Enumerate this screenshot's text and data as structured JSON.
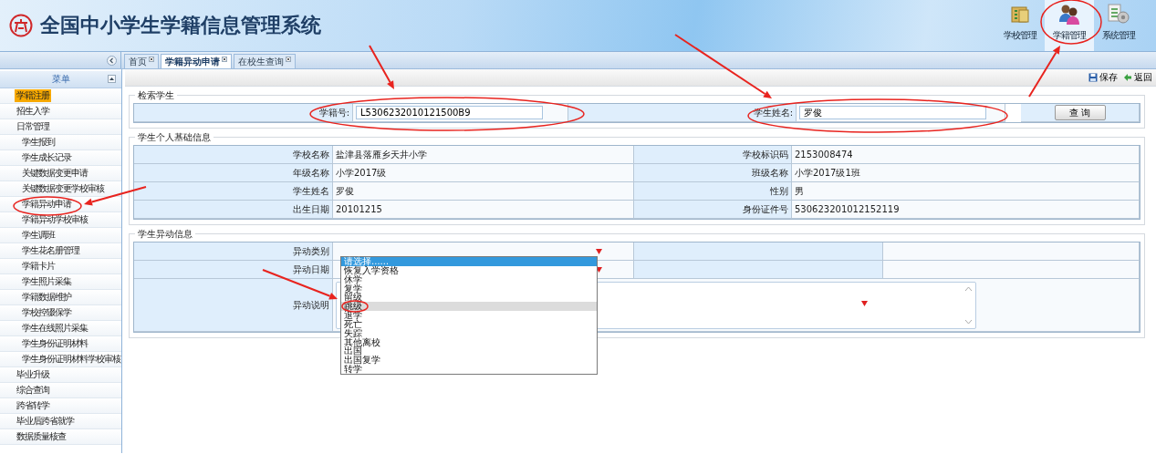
{
  "header": {
    "title": "全国中小学生学籍信息管理系统"
  },
  "top_nav": [
    {
      "label": "学校管理",
      "selected": false
    },
    {
      "label": "学籍管理",
      "selected": true
    },
    {
      "label": "系统管理",
      "selected": false
    }
  ],
  "sidebar": {
    "title": "菜单",
    "items": [
      {
        "label": "学籍注册",
        "selected": true
      },
      {
        "label": "招生入学",
        "selected": false
      },
      {
        "label": "日常管理",
        "selected": false,
        "children": [
          {
            "label": "学生报到",
            "selected": false
          },
          {
            "label": "学生成长记录",
            "selected": false
          },
          {
            "label": "关键数据变更申请",
            "selected": false
          },
          {
            "label": "关键数据变更学校审核",
            "selected": false
          },
          {
            "label": "学籍异动申请",
            "selected": false
          },
          {
            "label": "学籍异动学校审核",
            "selected": false
          },
          {
            "label": "学生调班",
            "selected": false
          },
          {
            "label": "学生花名册管理",
            "selected": false
          },
          {
            "label": "学籍卡片",
            "selected": false
          },
          {
            "label": "学生照片采集",
            "selected": false
          },
          {
            "label": "学籍数据维护",
            "selected": false
          },
          {
            "label": "学校控辍保学",
            "selected": false
          },
          {
            "label": "学生在线照片采集",
            "selected": false
          },
          {
            "label": "学生身份证明材料",
            "selected": false
          },
          {
            "label": "学生身份证明材料学校审核",
            "selected": false
          }
        ]
      },
      {
        "label": "毕业升级",
        "selected": false
      },
      {
        "label": "综合查询",
        "selected": false
      },
      {
        "label": "跨省转学",
        "selected": false
      },
      {
        "label": "毕业后跨省就学",
        "selected": false
      },
      {
        "label": "数据质量核查",
        "selected": false
      }
    ]
  },
  "tabs": [
    {
      "label": "首页",
      "selected": false
    },
    {
      "label": "学籍异动申请",
      "selected": true
    },
    {
      "label": "在校生查询",
      "selected": false
    }
  ],
  "toolbar": [
    {
      "label": "保存"
    },
    {
      "label": "返回"
    }
  ],
  "search": {
    "title": "检索学生",
    "fields": [
      {
        "label": "学籍号:",
        "value": "L5306232010121500B9"
      },
      {
        "label": "学生姓名:",
        "value": "罗俊"
      }
    ],
    "button": "查 询"
  },
  "basic_info": {
    "title": "学生个人基础信息",
    "rows": [
      [
        {
          "label": "学校名称",
          "value": "盐津县落雁乡天井小学"
        },
        {
          "label": "学校标识码",
          "value": "2153008474"
        }
      ],
      [
        {
          "label": "年级名称",
          "value": "小学2017级"
        },
        {
          "label": "班级名称",
          "value": "小学2017级1班"
        }
      ],
      [
        {
          "label": "学生姓名",
          "value": "罗俊"
        },
        {
          "label": "性别",
          "value": "男"
        }
      ],
      [
        {
          "label": "出生日期",
          "value": "20101215"
        },
        {
          "label": "身份证件号",
          "value": "530623201012152119"
        }
      ]
    ]
  },
  "change_info": {
    "title": "学生异动信息",
    "fields": [
      {
        "label": "异动类别",
        "kind": "select",
        "required": true
      },
      {
        "label": "异动日期",
        "kind": "date",
        "required": true
      },
      {
        "label": "异动说明",
        "kind": "textarea",
        "required": true
      }
    ],
    "dropdown": {
      "options": [
        {
          "label": "请选择……",
          "selected": true,
          "hovered": false
        },
        {
          "label": "恢复入学资格",
          "selected": false,
          "hovered": false
        },
        {
          "label": "休学",
          "selected": false,
          "hovered": false
        },
        {
          "label": "复学",
          "selected": false,
          "hovered": false
        },
        {
          "label": "留级",
          "selected": false,
          "hovered": false
        },
        {
          "label": "跳级",
          "selected": false,
          "hovered": true
        },
        {
          "label": "退学",
          "selected": false,
          "hovered": false
        },
        {
          "label": "死亡",
          "selected": false,
          "hovered": false
        },
        {
          "label": "失踪",
          "selected": false,
          "hovered": false
        },
        {
          "label": "其他离校",
          "selected": false,
          "hovered": false
        },
        {
          "label": "出国",
          "selected": false,
          "hovered": false
        },
        {
          "label": "出国复学",
          "selected": false,
          "hovered": false
        },
        {
          "label": "转学",
          "selected": false,
          "hovered": false
        }
      ]
    }
  }
}
